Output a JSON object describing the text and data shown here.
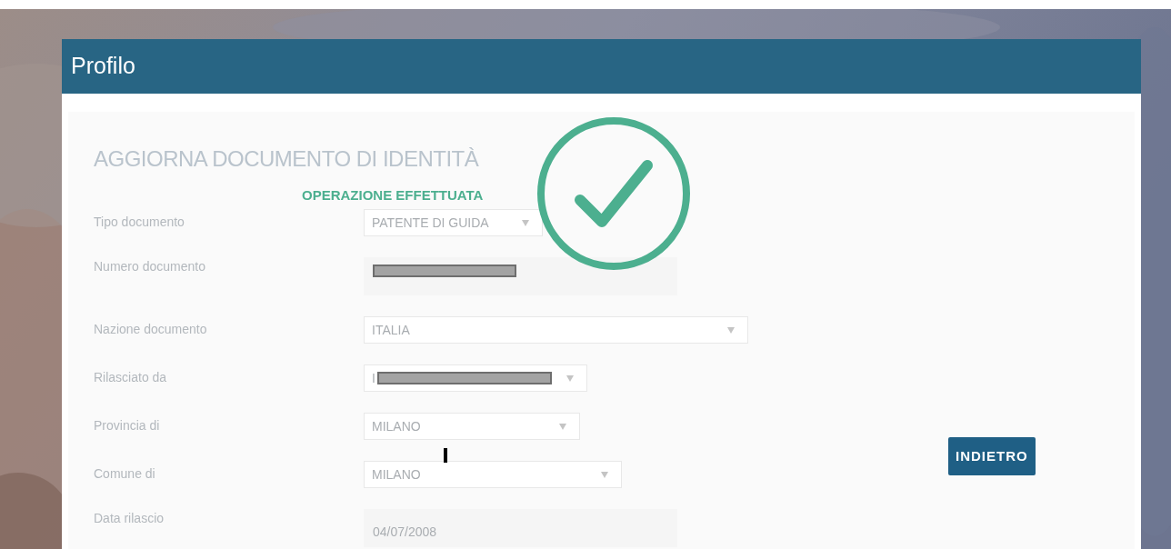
{
  "panel": {
    "title": "Profilo"
  },
  "form": {
    "heading": "AGGIORNA DOCUMENTO DI IDENTITÀ",
    "fields": [
      {
        "label": "Tipo documento",
        "kind": "select",
        "value": "PATENTE DI GUIDA",
        "redacted": false
      },
      {
        "label": "Numero documento",
        "kind": "readonly",
        "redacted": true
      },
      {
        "label": "Nazione documento",
        "kind": "select",
        "value": "ITALIA",
        "redacted": false
      },
      {
        "label": "Rilasciato da",
        "kind": "select",
        "value": "I",
        "redacted": true
      },
      {
        "label": "Provincia di",
        "kind": "select",
        "value": "MILANO",
        "redacted": false
      },
      {
        "label": "Comune di",
        "kind": "select",
        "value": "MILANO",
        "redacted": false
      },
      {
        "label": "Data rilascio",
        "kind": "readonly",
        "value": "04/07/2008",
        "redacted": false
      }
    ],
    "back_button": "INDIETRO"
  },
  "success": {
    "message": "OPERAZIONE EFFETTUATA"
  }
}
